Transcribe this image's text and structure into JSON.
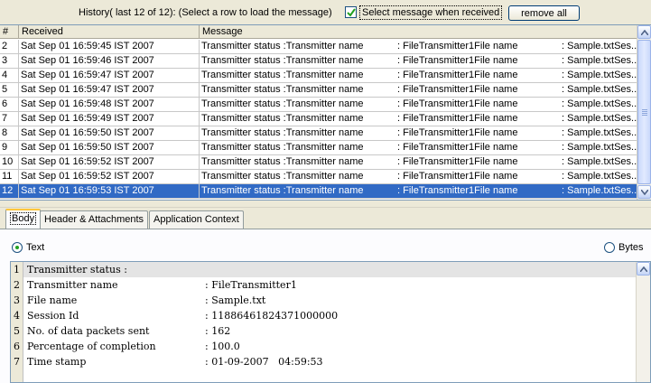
{
  "toolbar": {
    "history_label": "History( last 12 of 12):   (Select a row to load the message)",
    "select_checkbox_checked": true,
    "select_label": "Select message when received",
    "remove_all_label": "remove all"
  },
  "table": {
    "columns": [
      "#",
      "Received",
      "Message"
    ],
    "rows": [
      {
        "num": "2",
        "received": "Sat Sep 01 16:59:45 IST 2007",
        "msg_a": "Transmitter status :Transmitter name",
        "msg_b": ": FileTransmitter1File name",
        "msg_c": ": Sample.txtSes..."
      },
      {
        "num": "3",
        "received": "Sat Sep 01 16:59:46 IST 2007",
        "msg_a": "Transmitter status :Transmitter name",
        "msg_b": ": FileTransmitter1File name",
        "msg_c": ": Sample.txtSes..."
      },
      {
        "num": "4",
        "received": "Sat Sep 01 16:59:47 IST 2007",
        "msg_a": "Transmitter status :Transmitter name",
        "msg_b": ": FileTransmitter1File name",
        "msg_c": ": Sample.txtSes..."
      },
      {
        "num": "5",
        "received": "Sat Sep 01 16:59:47 IST 2007",
        "msg_a": "Transmitter status :Transmitter name",
        "msg_b": ": FileTransmitter1File name",
        "msg_c": ": Sample.txtSes..."
      },
      {
        "num": "6",
        "received": "Sat Sep 01 16:59:48 IST 2007",
        "msg_a": "Transmitter status :Transmitter name",
        "msg_b": ": FileTransmitter1File name",
        "msg_c": ": Sample.txtSes..."
      },
      {
        "num": "7",
        "received": "Sat Sep 01 16:59:49 IST 2007",
        "msg_a": "Transmitter status :Transmitter name",
        "msg_b": ": FileTransmitter1File name",
        "msg_c": ": Sample.txtSes..."
      },
      {
        "num": "8",
        "received": "Sat Sep 01 16:59:50 IST 2007",
        "msg_a": "Transmitter status :Transmitter name",
        "msg_b": ": FileTransmitter1File name",
        "msg_c": ": Sample.txtSes..."
      },
      {
        "num": "9",
        "received": "Sat Sep 01 16:59:50 IST 2007",
        "msg_a": "Transmitter status :Transmitter name",
        "msg_b": ": FileTransmitter1File name",
        "msg_c": ": Sample.txtSes..."
      },
      {
        "num": "10",
        "received": "Sat Sep 01 16:59:52 IST 2007",
        "msg_a": "Transmitter status :Transmitter name",
        "msg_b": ": FileTransmitter1File name",
        "msg_c": ": Sample.txtSes..."
      },
      {
        "num": "11",
        "received": "Sat Sep 01 16:59:52 IST 2007",
        "msg_a": "Transmitter status :Transmitter name",
        "msg_b": ": FileTransmitter1File name",
        "msg_c": ": Sample.txtSes..."
      },
      {
        "num": "12",
        "received": "Sat Sep 01 16:59:53 IST 2007",
        "msg_a": "Transmitter status :Transmitter name",
        "msg_b": ": FileTransmitter1File name",
        "msg_c": ": Sample.txtSes..."
      }
    ],
    "selected_row": "12"
  },
  "tabs": [
    {
      "label": "Body",
      "active": true
    },
    {
      "label": "Header & Attachments",
      "active": false
    },
    {
      "label": "Application Context",
      "active": false
    }
  ],
  "body_format": {
    "text_label": "Text",
    "bytes_label": "Bytes",
    "selected": "Text"
  },
  "editor": {
    "lines": [
      {
        "num": "1",
        "key": "Transmitter status :",
        "value": ""
      },
      {
        "num": "2",
        "key": "Transmitter name",
        "value": ": FileTransmitter1"
      },
      {
        "num": "3",
        "key": "File name",
        "value": ": Sample.txt"
      },
      {
        "num": "4",
        "key": "Session Id",
        "value": ": 11886461824371000000"
      },
      {
        "num": "5",
        "key": "No. of data packets sent",
        "value": ": 162"
      },
      {
        "num": "6",
        "key": "Percentage of completion",
        "value": ": 100.0"
      },
      {
        "num": "7",
        "key": "Time stamp",
        "value": ": 01-09-2007   04:59:53"
      }
    ]
  },
  "colors": {
    "selection": "#316ac5",
    "window_bg": "#ece9d8",
    "tab_highlight": "#ffc73c"
  }
}
